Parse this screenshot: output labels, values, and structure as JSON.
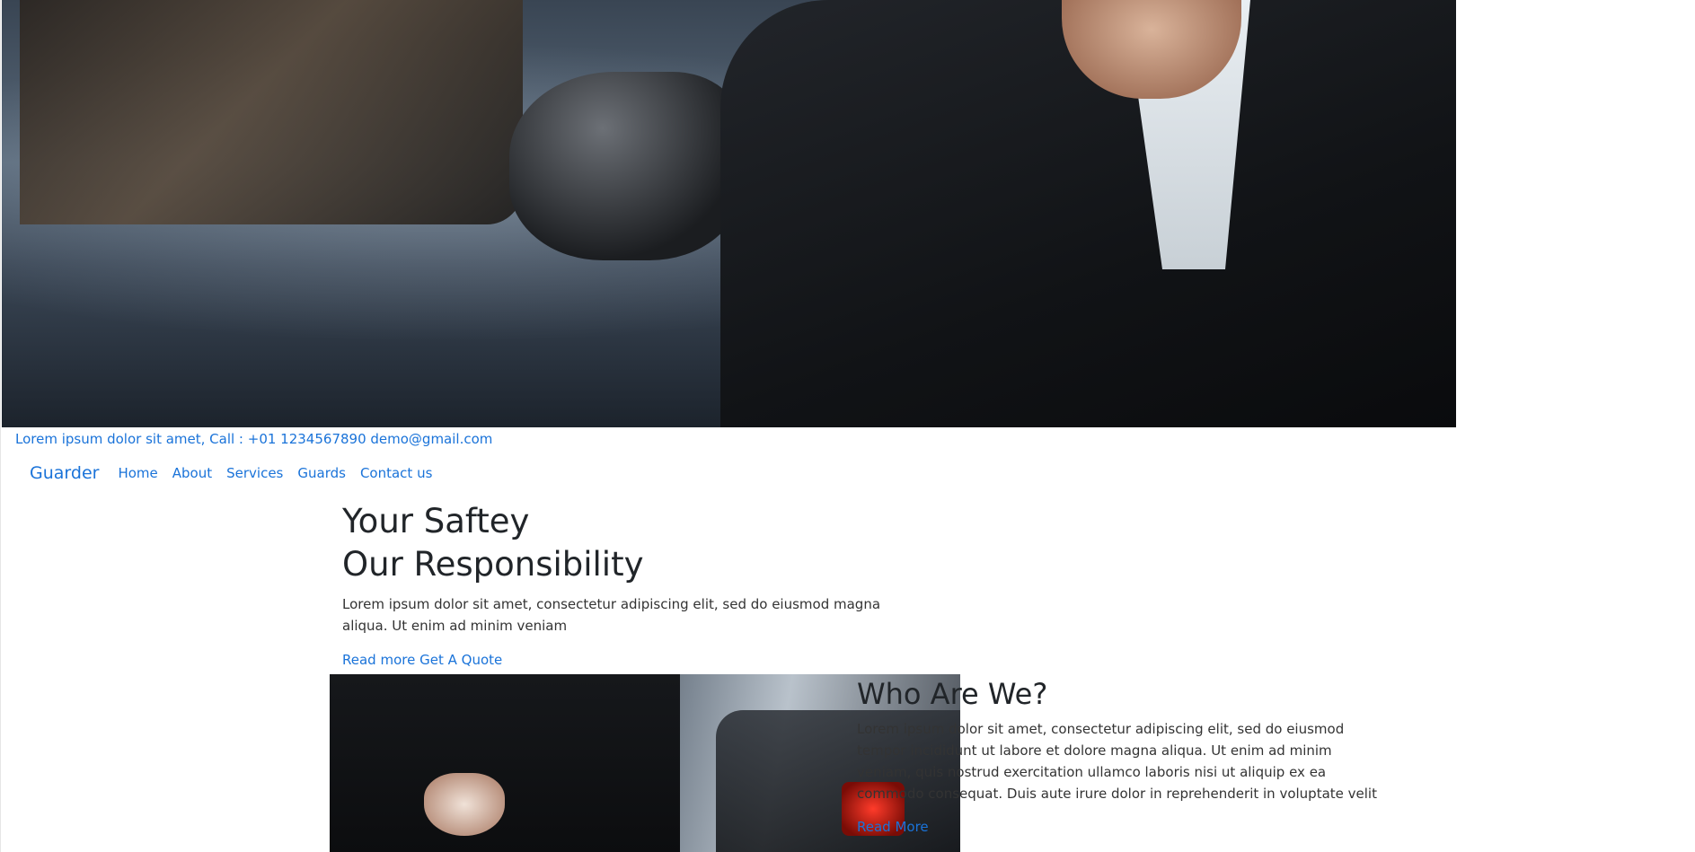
{
  "topbar": {
    "text": "Lorem ipsum dolor sit amet, Call : +01 1234567890 demo@gmail.com"
  },
  "nav": {
    "brand": "Guarder",
    "items": [
      {
        "label": "Home"
      },
      {
        "label": "About"
      },
      {
        "label": "Services"
      },
      {
        "label": "Guards"
      },
      {
        "label": "Contact us"
      }
    ]
  },
  "hero": {
    "title_line1": "Your Saftey",
    "title_line2": "Our Responsibility",
    "description": "Lorem ipsum dolor sit amet, consectetur adipiscing elit, sed do eiusmod magna aliqua. Ut enim ad minim veniam",
    "read_more": "Read more",
    "get_quote": "Get A Quote"
  },
  "about": {
    "title": "Who Are We?",
    "description": "Lorem ipsum dolor sit amet, consectetur adipiscing elit, sed do eiusmod tempor incididunt ut labore et dolore magna aliqua. Ut enim ad minim veniam, quis nostrud exercitation ullamco laboris nisi ut aliquip ex ea commodo consequat. Duis aute irure dolor in reprehenderit in voluptate velit",
    "read_more": "Read More"
  },
  "colors": {
    "link": "#1a73d9",
    "heading": "#212529"
  }
}
